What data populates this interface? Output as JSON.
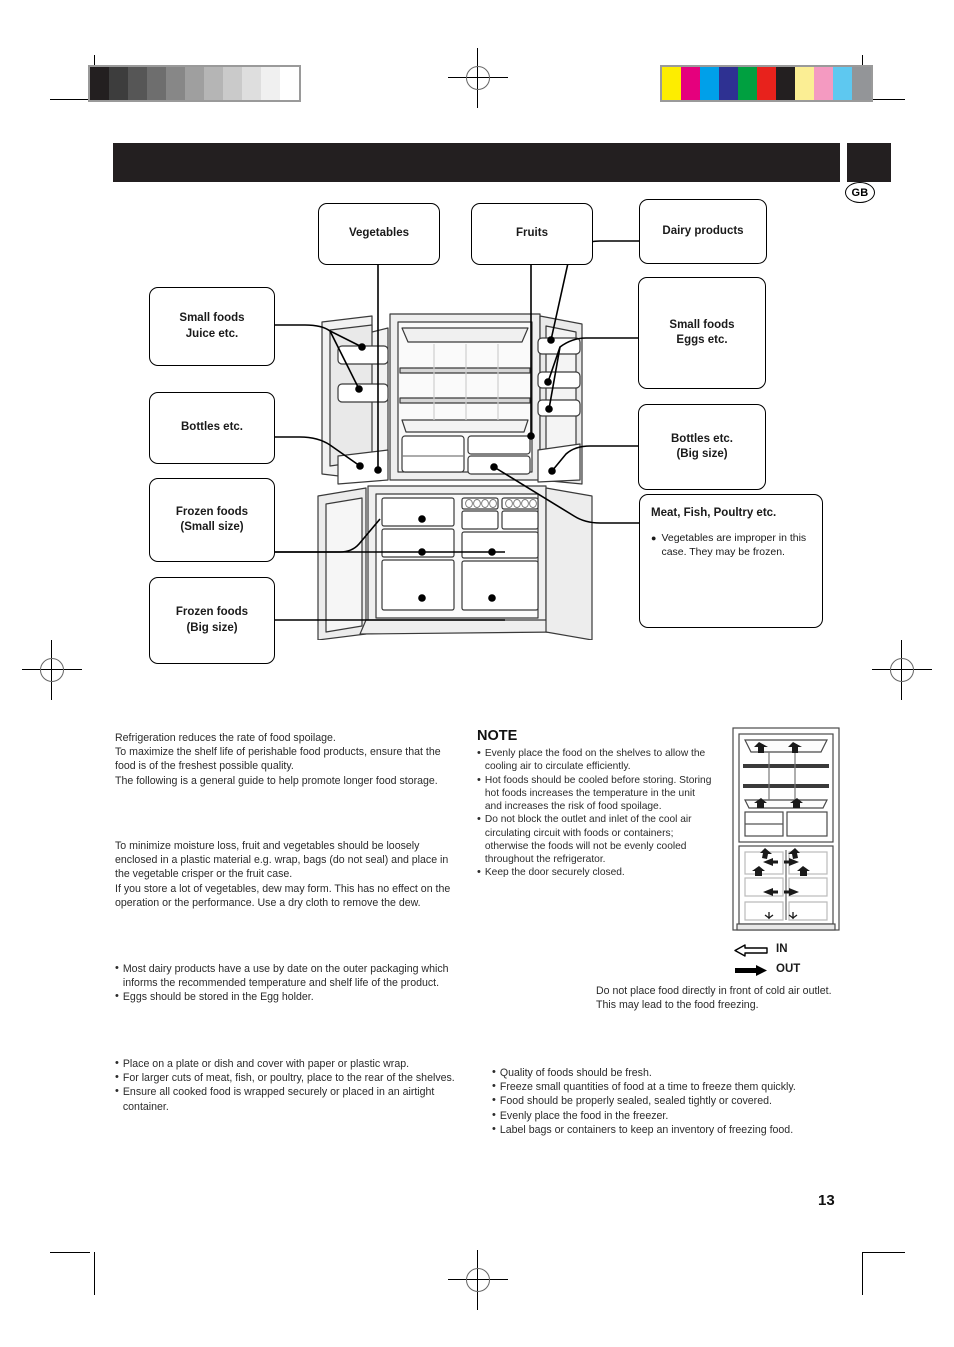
{
  "page": {
    "number": "13",
    "locale_badge": "GB"
  },
  "print_marks": {
    "step_wedge": [
      "#231f20",
      "#3d3d3d",
      "#565656",
      "#6e6e6e",
      "#878787",
      "#9f9f9f",
      "#b5b5b5",
      "#cacaca",
      "#dedede",
      "#f0f0f0",
      "#ffffff"
    ],
    "color_bar": [
      "#fded00",
      "#e5007d",
      "#00a0e9",
      "#2e3192",
      "#00a040",
      "#e8221c",
      "#231f20",
      "#fbee94",
      "#f49ac1",
      "#5ec8f0",
      "#939598"
    ]
  },
  "diagram": {
    "callouts": [
      {
        "id": "vegetables",
        "title": "Vegetables"
      },
      {
        "id": "fruits",
        "title": "Fruits"
      },
      {
        "id": "dairy-products",
        "title": "Dairy products"
      },
      {
        "id": "small-foods-juice",
        "title": "Small foods",
        "title2": "Juice etc."
      },
      {
        "id": "small-foods-eggs",
        "title": "Small foods",
        "title2": "Eggs etc."
      },
      {
        "id": "bottles",
        "title": "Bottles etc."
      },
      {
        "id": "bottles-big",
        "title": "Bottles etc.",
        "title2": "(Big size)"
      },
      {
        "id": "frozen-small",
        "title": "Frozen foods",
        "title2": "(Small size)"
      },
      {
        "id": "frozen-big",
        "title": "Frozen foods",
        "title2": "(Big size)"
      },
      {
        "id": "meat-fish-poultry",
        "title": "Meat, Fish, Poultry etc.",
        "bullet": "Vegetables are improper in this case. They may be frozen."
      }
    ]
  },
  "body": {
    "general": [
      "Refrigeration reduces the rate of food spoilage.",
      "To maximize the shelf life of perishable food products, ensure that the food is of the freshest possible quality.",
      "The following is a general guide to help promote longer food storage."
    ],
    "vegetables": [
      "To minimize moisture loss, fruit and vegetables should be loosely enclosed in a plastic material e.g. wrap, bags (do not seal) and place in the vegetable crisper or the fruit case.",
      "If you store a lot of vegetables, dew may form. This has no effect on the operation or the performance. Use a dry cloth to remove the dew."
    ],
    "dairy": [
      "Most dairy products have a use by date on the outer packaging which informs the recommended temperature and shelf life of the product.",
      "Eggs should be stored in the Egg holder."
    ],
    "meat": [
      "Place on a plate or dish and cover with paper or plastic wrap.",
      "For larger cuts of meat, fish, or poultry, place to the rear of the shelves.",
      "Ensure all cooked food is wrapped securely or placed in an airtight container."
    ],
    "freezing": [
      "Quality of foods should be fresh.",
      "Freeze small quantities of food at a time to freeze them quickly.",
      "Food should be properly sealed, sealed tightly or covered.",
      "Evenly place the food in the freezer.",
      "Label bags or containers to keep an inventory of freezing food."
    ]
  },
  "note": {
    "heading": "NOTE",
    "items": [
      "Evenly place the food on the shelves to allow the cooling air to circulate efficiently.",
      "Hot foods should be cooled before storing. Storing hot foods increases the temperature in the unit and increases the risk of food spoilage.",
      "Do not block the outlet and inlet of the cool air circulating circuit with foods or containers; otherwise the foods will not be evenly cooled throughout the refrigerator.",
      "Keep the door securely closed."
    ]
  },
  "airflow": {
    "legend": [
      {
        "id": "in",
        "label": "IN",
        "arrow": "hollow-left-arrow-icon"
      },
      {
        "id": "out",
        "label": "OUT",
        "arrow": "solid-right-arrow-icon"
      }
    ],
    "caption": "Do not place food directly in front of cold air outlet. This may lead to the food freezing."
  }
}
